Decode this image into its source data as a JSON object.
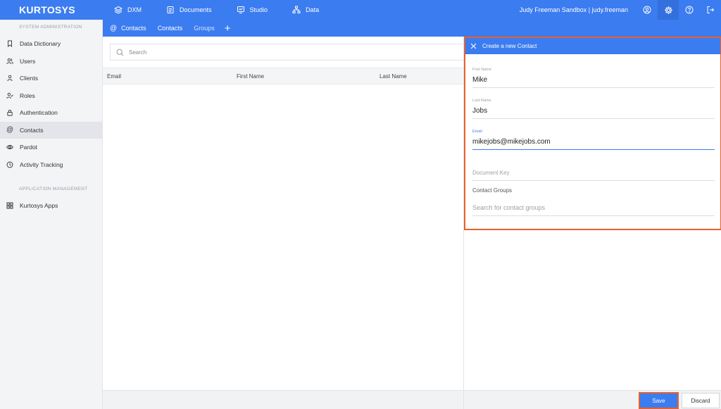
{
  "app": {
    "logo": "KURTOSYS"
  },
  "topnav": [
    {
      "label": "DXM",
      "icon": "layers-icon"
    },
    {
      "label": "Documents",
      "icon": "documents-icon"
    },
    {
      "label": "Studio",
      "icon": "studio-icon"
    },
    {
      "label": "Data",
      "icon": "hierarchy-icon"
    }
  ],
  "user": {
    "label": "Judy Freeman Sandbox | judy.freeman"
  },
  "subbar": {
    "icon": "at-icon",
    "section": "Contacts",
    "tab_contacts": "Contacts",
    "tab_groups": "Groups",
    "add": "+"
  },
  "sidebar": {
    "section1": "SYSTEM ADMINISTRATION",
    "items": [
      {
        "label": "Data Dictionary",
        "icon": "bookmark-icon"
      },
      {
        "label": "Users",
        "icon": "users-icon"
      },
      {
        "label": "Clients",
        "icon": "user-icon"
      },
      {
        "label": "Roles",
        "icon": "user-check-icon"
      },
      {
        "label": "Authentication",
        "icon": "lock-icon"
      },
      {
        "label": "Contacts",
        "icon": "at-icon"
      },
      {
        "label": "Pardot",
        "icon": "eye-icon"
      },
      {
        "label": "Activity Tracking",
        "icon": "clock-icon"
      }
    ],
    "section2": "APPLICATION MANAGEMENT",
    "apps": {
      "label": "Kurtosys Apps",
      "icon": "grid-icon"
    }
  },
  "search": {
    "placeholder": "Search"
  },
  "table": {
    "columns": [
      "Email",
      "First Name",
      "Last Name"
    ]
  },
  "panel": {
    "title": "Create a new Contact",
    "first_name": {
      "label": "First Name",
      "value": "Mike"
    },
    "last_name": {
      "label": "Last Name",
      "value": "Jobs"
    },
    "email": {
      "label": "Email",
      "value": "mikejobs@mikejobs.com"
    },
    "document_key": {
      "placeholder": "Document Key"
    },
    "contact_groups": {
      "label": "Contact Groups",
      "placeholder": "Search for contact groups"
    }
  },
  "buttons": {
    "save": "Save",
    "discard": "Discard"
  },
  "colors": {
    "primary": "#3b7cf0",
    "highlight": "#e8602c"
  }
}
